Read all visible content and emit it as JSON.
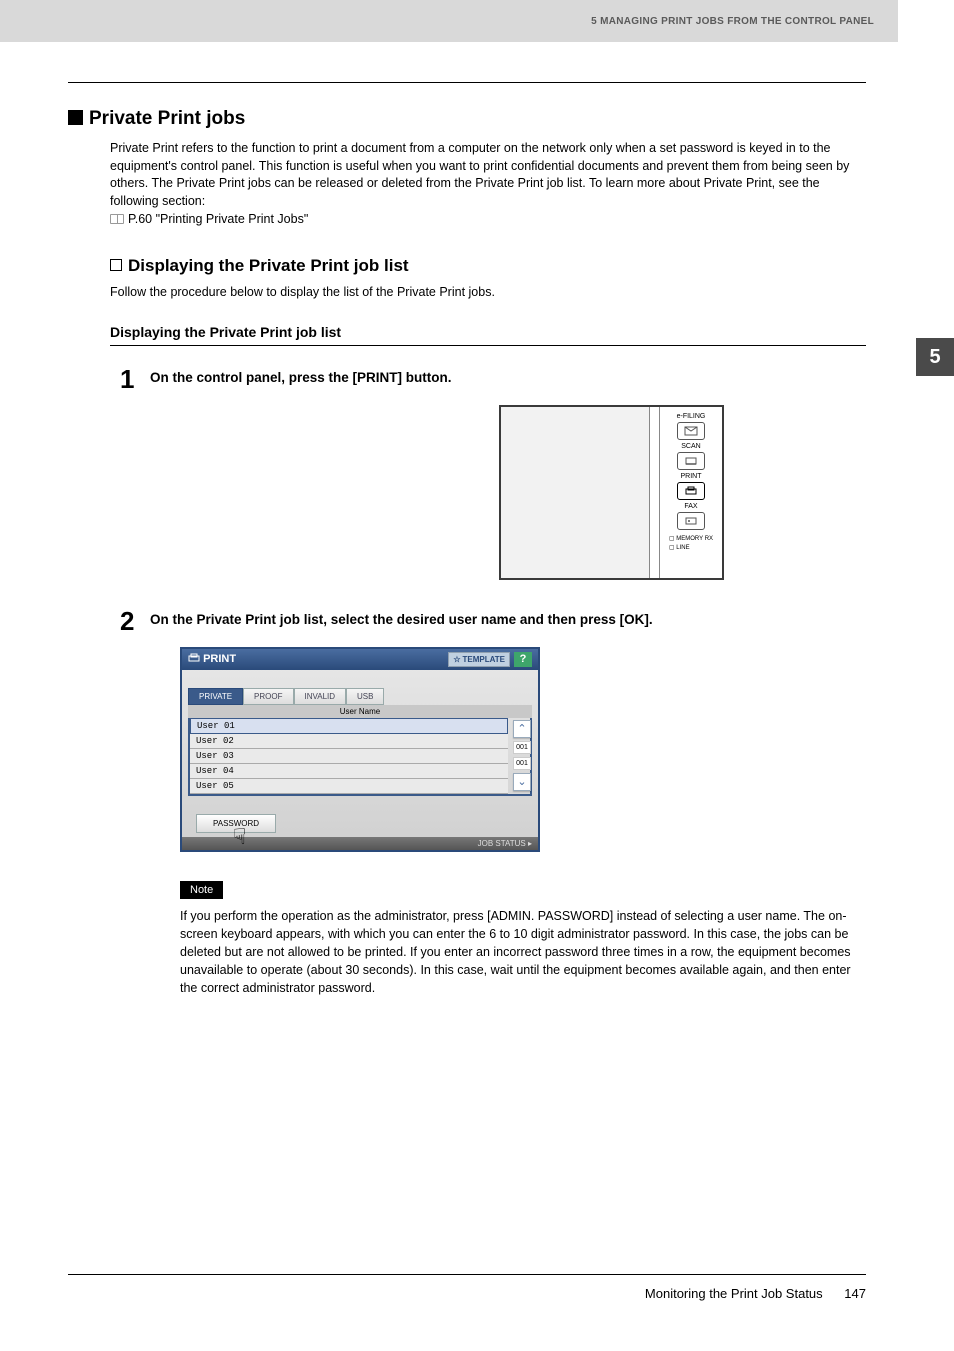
{
  "header": {
    "chapter_label": "5 MANAGING PRINT JOBS FROM THE CONTROL PANEL"
  },
  "side_tab": "5",
  "section": {
    "h1": "Private Print jobs",
    "intro": "Private Print refers to the function to print a document from a computer on the network only when a set password is keyed in to the equipment's control panel. This function is useful when you want to print confidential documents and prevent them from being seen by others. The Private Print jobs can be released or deleted from the Private Print job list. To learn more about Private Print, see the following section:",
    "ref": "P.60 \"Printing Private Print Jobs\"",
    "h2": "Displaying the Private Print job list",
    "h2_sub": "Follow the procedure below to display the list of the Private Print jobs.",
    "h3": "Displaying the Private Print job list"
  },
  "steps": [
    {
      "num": "1",
      "text": "On the control panel, press the [PRINT] button."
    },
    {
      "num": "2",
      "text": "On the Private Print job list, select the desired user name and then press [OK]."
    }
  ],
  "control_panel": {
    "btns": [
      {
        "label": "e-FILING"
      },
      {
        "label": "SCAN"
      },
      {
        "label": "PRINT"
      },
      {
        "label": "FAX"
      }
    ],
    "leds": [
      "MEMORY RX",
      "LINE"
    ]
  },
  "screen": {
    "title": "PRINT",
    "template_btn": "TEMPLATE",
    "help": "?",
    "tabs": [
      "PRIVATE",
      "PROOF",
      "INVALID",
      "USB"
    ],
    "column_header": "User Name",
    "users": [
      "User 01",
      "User 02",
      "User 03",
      "User 04",
      "User 05"
    ],
    "page_top": "001",
    "page_bottom": "001",
    "password_btn": "PASSWORD",
    "footer": "JOB STATUS"
  },
  "note": {
    "label": "Note",
    "text": "If you perform the operation as the administrator, press [ADMIN. PASSWORD] instead of selecting a user name. The on-screen keyboard appears, with which you can enter the 6 to 10 digit administrator password. In this case, the jobs can be deleted but are not allowed to be printed. If you enter an incorrect password three times in a row, the equipment becomes unavailable to operate (about 30 seconds). In this case, wait until the equipment becomes available again, and then enter the correct administrator password."
  },
  "footer": {
    "text": "Monitoring the Print Job Status",
    "page": "147"
  }
}
